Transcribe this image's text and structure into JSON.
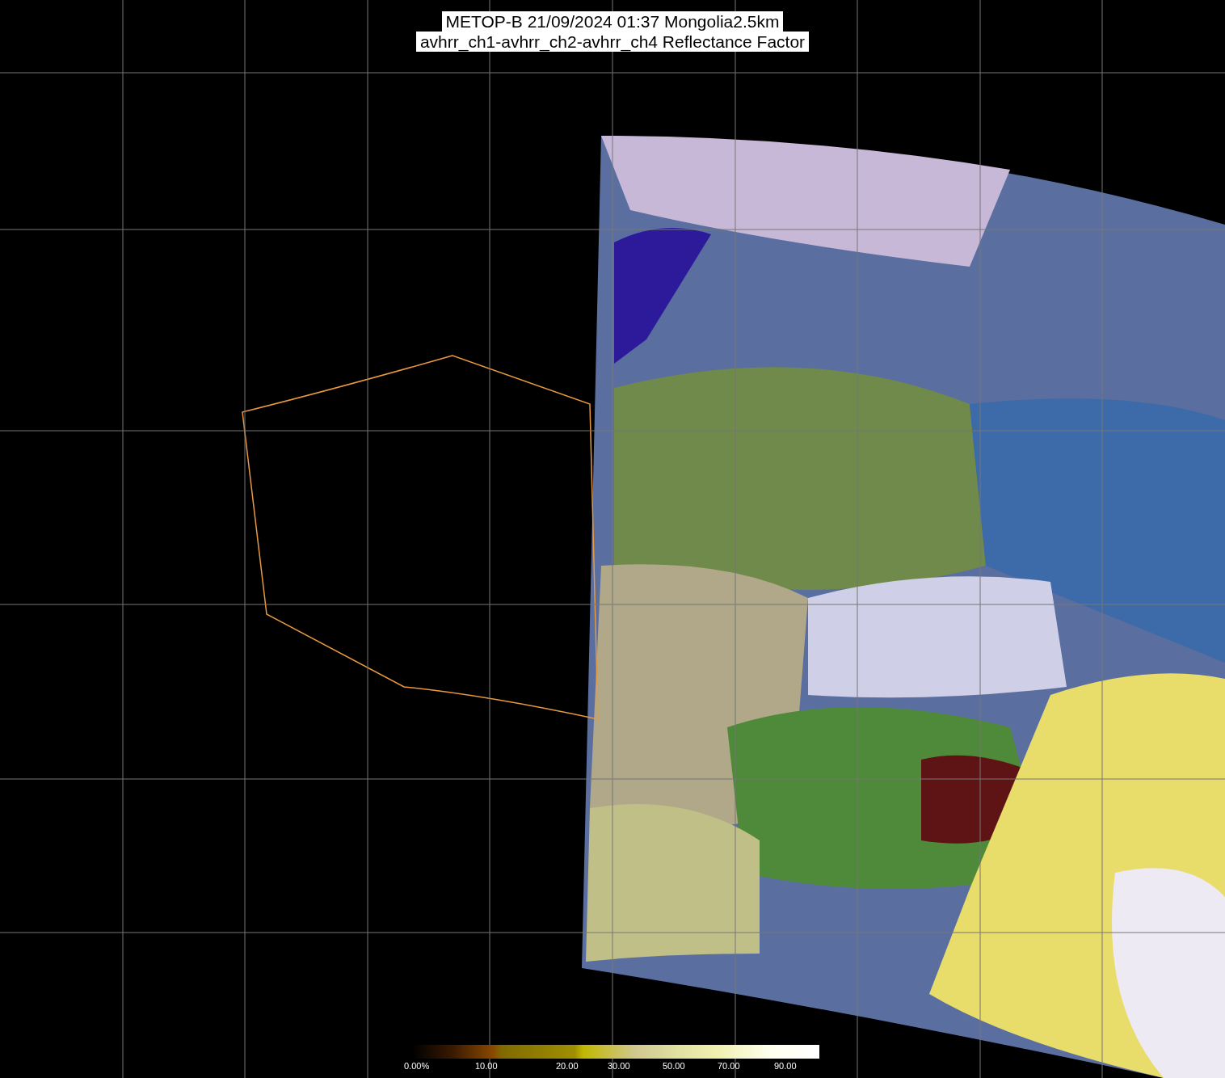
{
  "title_lines": [
    "METOP-B 21/09/2024 01:37 Mongolia2.5km",
    "avhrr_ch1-avhrr_ch2-avhrr_ch4 Reflectance Factor"
  ],
  "colorbar": {
    "labels": [
      "0.00%",
      "10.00",
      "20.00",
      "30.00",
      "50.00",
      "70.00",
      "90.00"
    ]
  }
}
